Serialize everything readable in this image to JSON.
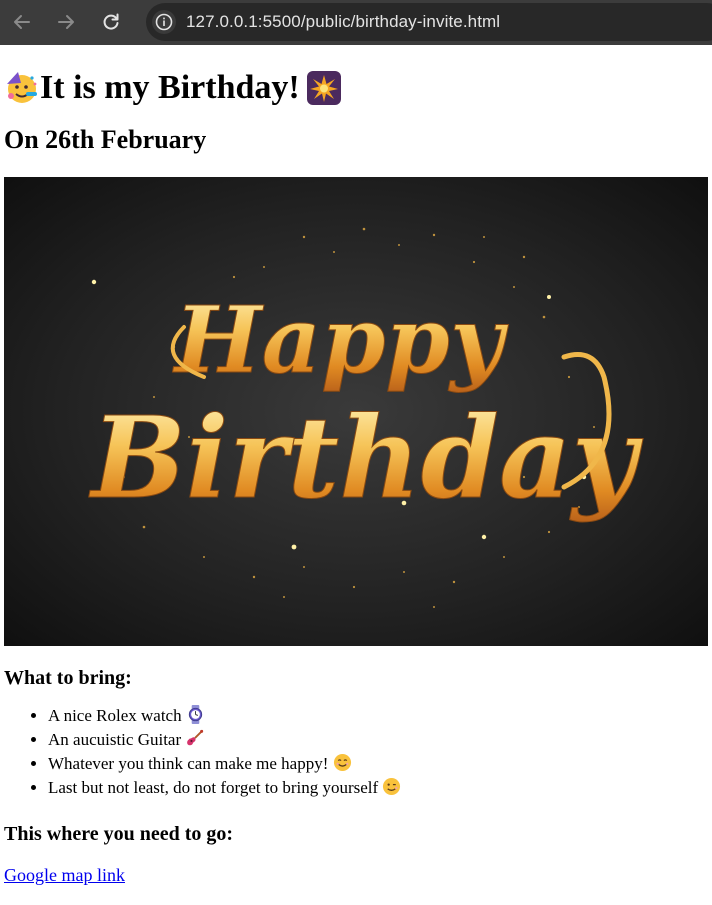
{
  "browser": {
    "url": "127.0.0.1:5500/public/birthday-invite.html",
    "icons": [
      "back-arrow-icon",
      "forward-arrow-icon",
      "reload-icon",
      "site-info-icon"
    ]
  },
  "page": {
    "title": "It is my Birthday!",
    "subtitle": "On 26th February",
    "banner_text_line1": "Happy",
    "banner_text_line2": "Birthday",
    "bring_heading": "What to bring:",
    "bring_items": [
      "A nice Rolex watch",
      "An aucuistic Guitar",
      "Whatever you think can make me happy!",
      "Last but not least, do not forget to bring yourself"
    ],
    "go_heading": "This where you need to go:",
    "map_link": "Google map link"
  },
  "colors": {
    "chrome_bg": "#3c3c3c",
    "omnibox_bg": "#282828",
    "link": "#0000ee",
    "banner_gold": "#f2b84b"
  }
}
